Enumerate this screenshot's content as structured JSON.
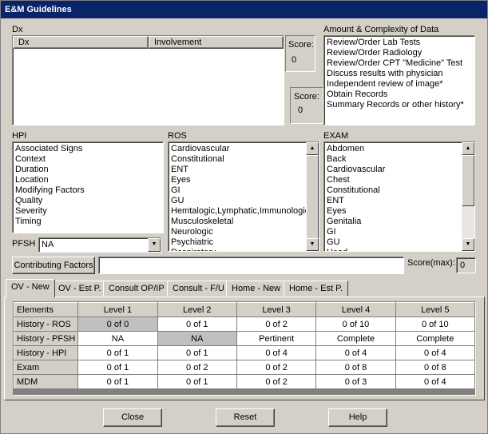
{
  "window": {
    "title": "E&M Guidelines"
  },
  "dx": {
    "label": "Dx",
    "columns": [
      "Dx",
      "Involvement"
    ],
    "score_label": "Score:",
    "score_value": "0"
  },
  "amount": {
    "label": "Amount & Complexity of Data",
    "items": [
      "Review/Order Lab Tests",
      "Review/Order Radiology",
      "Review/Order CPT \"Medicine\" Test",
      "Discuss results with physician",
      "Independent review of image*",
      "Obtain Records",
      "Summary Records or other history*"
    ],
    "score_label": "Score:",
    "score_value": "0"
  },
  "hpi": {
    "label": "HPI",
    "items": [
      "Associated Signs",
      "Context",
      "Duration",
      "Location",
      "Modifying Factors",
      "Quality",
      "Severity",
      "Timing"
    ]
  },
  "ros": {
    "label": "ROS",
    "items": [
      "Cardiovascular",
      "Constitutional",
      "ENT",
      "Eyes",
      "GI",
      "GU",
      "Hemtalogic,Lymphatic,Immunologic",
      "Musculoskeletal",
      "Neurologic",
      "Psychiatric",
      "Respiratory"
    ]
  },
  "exam": {
    "label": "EXAM",
    "items": [
      "Abdomen",
      "Back",
      "Cardiovascular",
      "Chest",
      "Constitutional",
      "ENT",
      "Eyes",
      "Genitalia",
      "GI",
      "GU",
      "Head"
    ]
  },
  "pfsh": {
    "label": "PFSH",
    "value": "NA"
  },
  "contributing": {
    "button_label": "Contributing Factors",
    "value": "",
    "score_label": "Score(max):",
    "score_value": "0"
  },
  "tabs": [
    "OV - New",
    "OV - Est P.",
    "Consult OP/IP",
    "Consult - F/U",
    "Home - New",
    "Home - Est P."
  ],
  "grid": {
    "header": [
      "Elements",
      "Level 1",
      "Level 2",
      "Level 3",
      "Level 4",
      "Level 5"
    ],
    "rows": [
      {
        "name": "History - ROS",
        "cells": [
          "0 of 0",
          "0 of 1",
          "0 of 2",
          "0 of 10",
          "0 of 10"
        ]
      },
      {
        "name": "History - PFSH",
        "cells": [
          "NA",
          "NA",
          "Pertinent",
          "Complete",
          "Complete"
        ]
      },
      {
        "name": "History - HPI",
        "cells": [
          "0 of 1",
          "0 of 1",
          "0 of 4",
          "0 of 4",
          "0 of 4"
        ]
      },
      {
        "name": "Exam",
        "cells": [
          "0 of 1",
          "0 of 2",
          "0 of 2",
          "0 of 8",
          "0 of 8"
        ]
      },
      {
        "name": "MDM",
        "cells": [
          "0 of 1",
          "0 of 1",
          "0 of 2",
          "0 of 3",
          "0 of 4"
        ]
      }
    ]
  },
  "buttons": {
    "close": "Close",
    "reset": "Reset",
    "help": "Help"
  },
  "colors": {
    "titlebar": "#0a246a",
    "face": "#d4d0c8",
    "cell_gray": "#c0c0c0"
  }
}
